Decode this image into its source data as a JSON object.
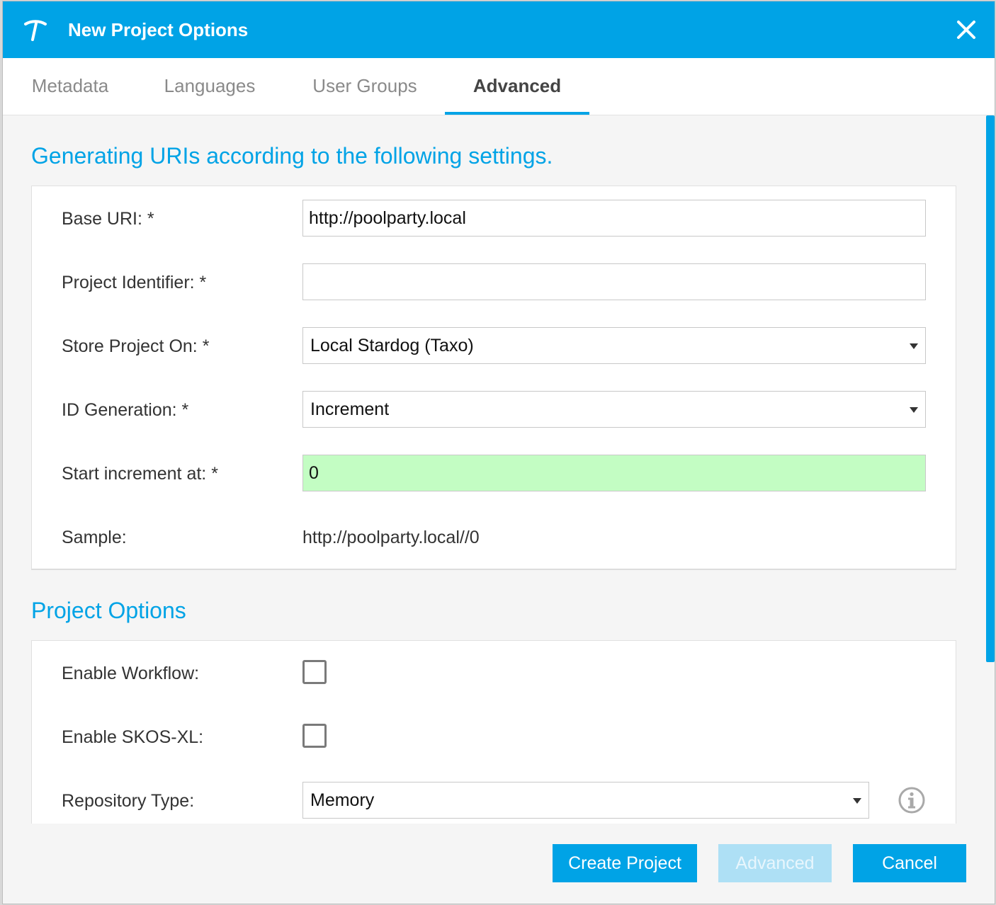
{
  "dialog": {
    "title": "New Project Options",
    "logo_icon": "pickaxe-logo-icon",
    "close_icon": "close-icon"
  },
  "tabs": [
    {
      "label": "Metadata",
      "active": false
    },
    {
      "label": "Languages",
      "active": false
    },
    {
      "label": "User Groups",
      "active": false
    },
    {
      "label": "Advanced",
      "active": true
    }
  ],
  "uri_section": {
    "title": "Generating URIs according to the following settings.",
    "base_uri": {
      "label": "Base URI: *",
      "value": "http://poolparty.local"
    },
    "project_identifier": {
      "label": "Project Identifier: *",
      "value": ""
    },
    "store_project_on": {
      "label": "Store Project On: *",
      "selected": "Local Stardog (Taxo)"
    },
    "id_generation": {
      "label": "ID Generation: *",
      "selected": "Increment"
    },
    "start_increment": {
      "label": "Start increment at: *",
      "value": "0"
    },
    "sample": {
      "label": "Sample:",
      "value": "http://poolparty.local//0"
    }
  },
  "options_section": {
    "title": "Project Options",
    "enable_workflow": {
      "label": "Enable Workflow:",
      "checked": false
    },
    "enable_skosxl": {
      "label": "Enable SKOS-XL:",
      "checked": false
    },
    "repository_type": {
      "label": "Repository Type:",
      "selected": "Memory",
      "info_icon": "info-icon"
    }
  },
  "footer": {
    "create_label": "Create Project",
    "advanced_label": "Advanced",
    "cancel_label": "Cancel"
  },
  "colors": {
    "accent": "#00a3e6",
    "valid_field": "#c3fdc3",
    "disabled_button": "#aee0f5"
  }
}
